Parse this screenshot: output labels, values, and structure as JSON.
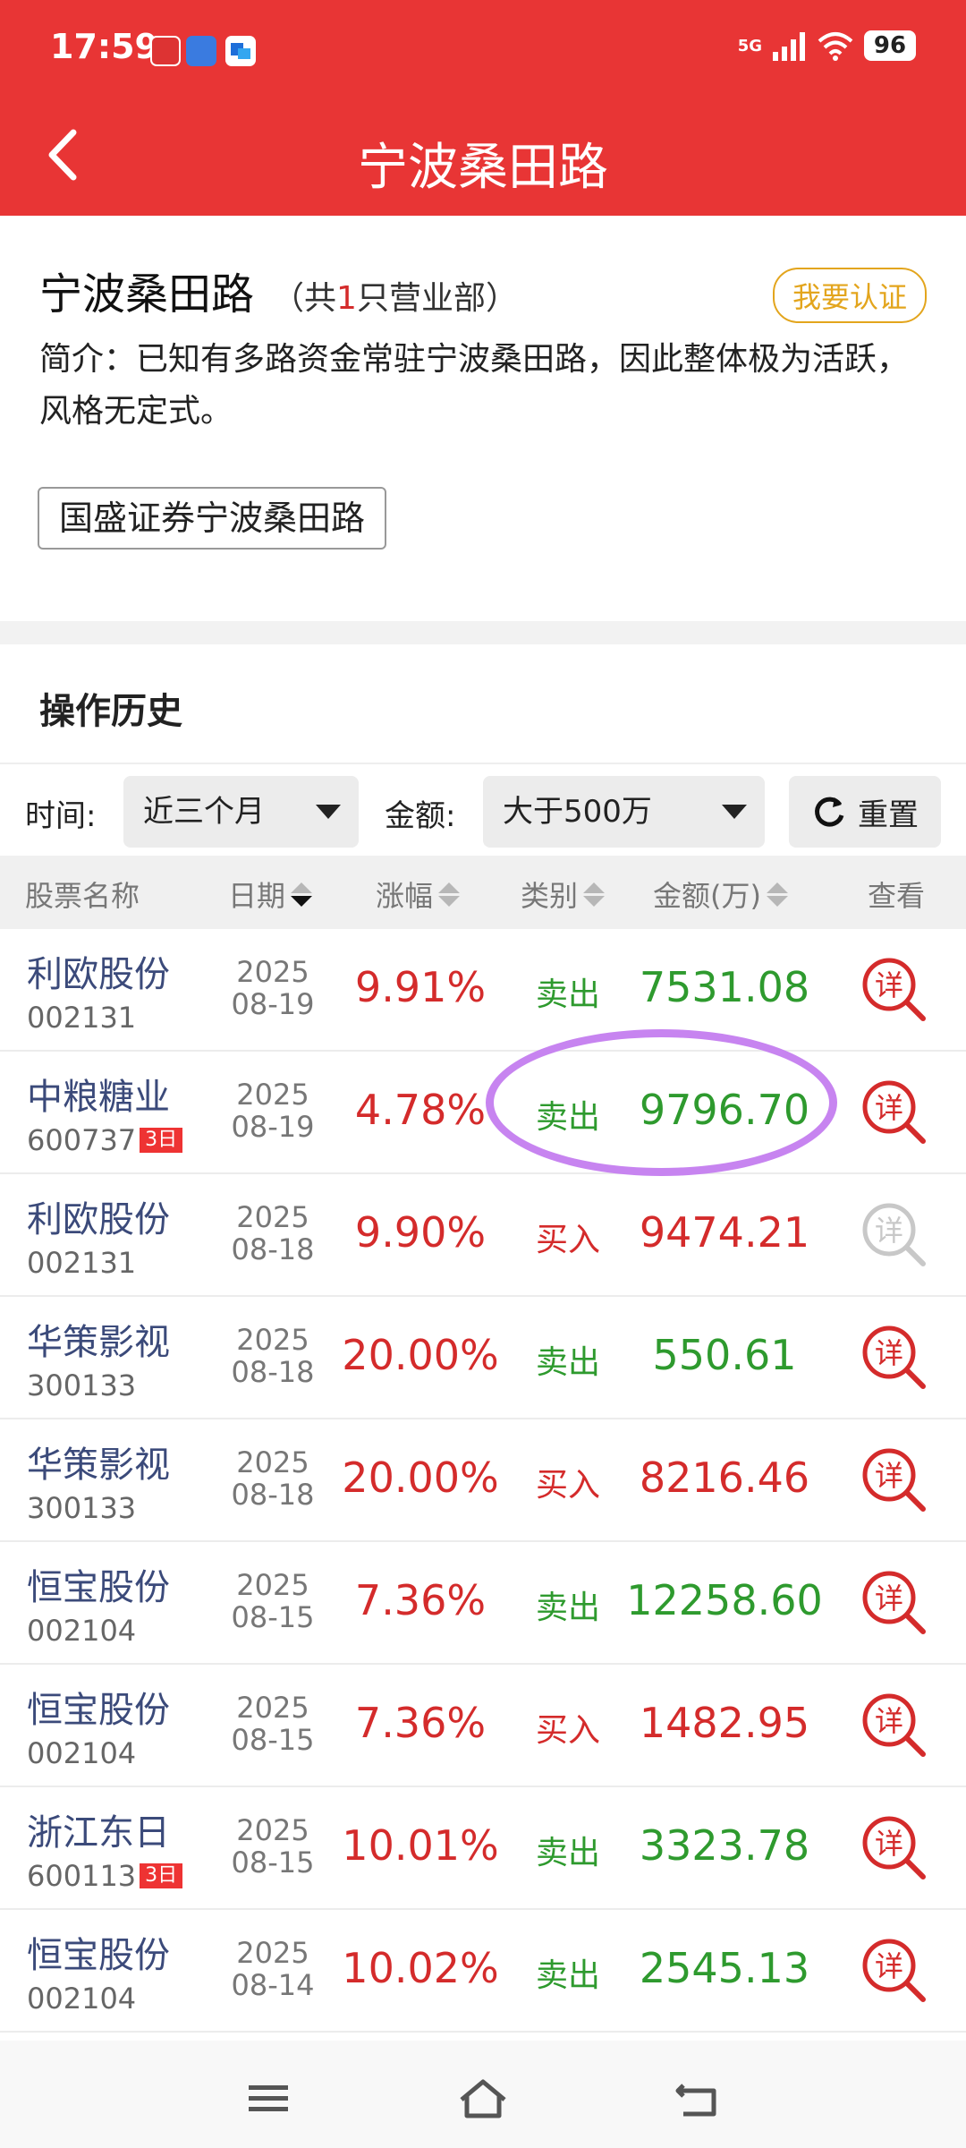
{
  "status_bar": {
    "time": "17:59",
    "network": "5G",
    "battery": "96"
  },
  "header": {
    "title": "宁波桑田路"
  },
  "broker": {
    "name": "宁波桑田路",
    "count_prefix": "（共",
    "count": "1",
    "count_suffix": "只营业部）",
    "certify_label": "我要认证",
    "intro": "简介：已知有多路资金常驻宁波桑田路，因此整体极为活跃，风格无定式。",
    "branch": "国盛证券宁波桑田路"
  },
  "history": {
    "title": "操作历史",
    "filters": {
      "time_label": "时间:",
      "time_value": "近三个月",
      "amount_label": "金额:",
      "amount_value": "大于500万",
      "reset_label": "重置"
    },
    "columns": {
      "name": "股票名称",
      "date": "日期",
      "change": "涨幅",
      "type": "类别",
      "amount": "金额(万)",
      "view": "查看"
    },
    "rows": [
      {
        "name": "利欧股份",
        "code": "002131",
        "badge": "",
        "year": "2025",
        "md": "08-19",
        "change": "9.91%",
        "type": "卖出",
        "amount": "7531.08"
      },
      {
        "name": "中粮糖业",
        "code": "600737",
        "badge": "3日",
        "year": "2025",
        "md": "08-19",
        "change": "4.78%",
        "type": "卖出",
        "amount": "9796.70"
      },
      {
        "name": "利欧股份",
        "code": "002131",
        "badge": "",
        "year": "2025",
        "md": "08-18",
        "change": "9.90%",
        "type": "买入",
        "amount": "9474.21"
      },
      {
        "name": "华策影视",
        "code": "300133",
        "badge": "",
        "year": "2025",
        "md": "08-18",
        "change": "20.00%",
        "type": "卖出",
        "amount": "550.61"
      },
      {
        "name": "华策影视",
        "code": "300133",
        "badge": "",
        "year": "2025",
        "md": "08-18",
        "change": "20.00%",
        "type": "买入",
        "amount": "8216.46"
      },
      {
        "name": "恒宝股份",
        "code": "002104",
        "badge": "",
        "year": "2025",
        "md": "08-15",
        "change": "7.36%",
        "type": "卖出",
        "amount": "12258.60"
      },
      {
        "name": "恒宝股份",
        "code": "002104",
        "badge": "",
        "year": "2025",
        "md": "08-15",
        "change": "7.36%",
        "type": "买入",
        "amount": "1482.95"
      },
      {
        "name": "浙江东日",
        "code": "600113",
        "badge": "3日",
        "year": "2025",
        "md": "08-15",
        "change": "10.01%",
        "type": "卖出",
        "amount": "3323.78"
      },
      {
        "name": "恒宝股份",
        "code": "002104",
        "badge": "",
        "year": "2025",
        "md": "08-14",
        "change": "10.02%",
        "type": "卖出",
        "amount": "2545.13"
      }
    ],
    "detail_glyph": "详"
  },
  "colors": {
    "header_red": "#e83535",
    "sell_green": "#2e9a2e",
    "buy_red": "#d42b2b",
    "highlight_purple": "#c784f0"
  }
}
